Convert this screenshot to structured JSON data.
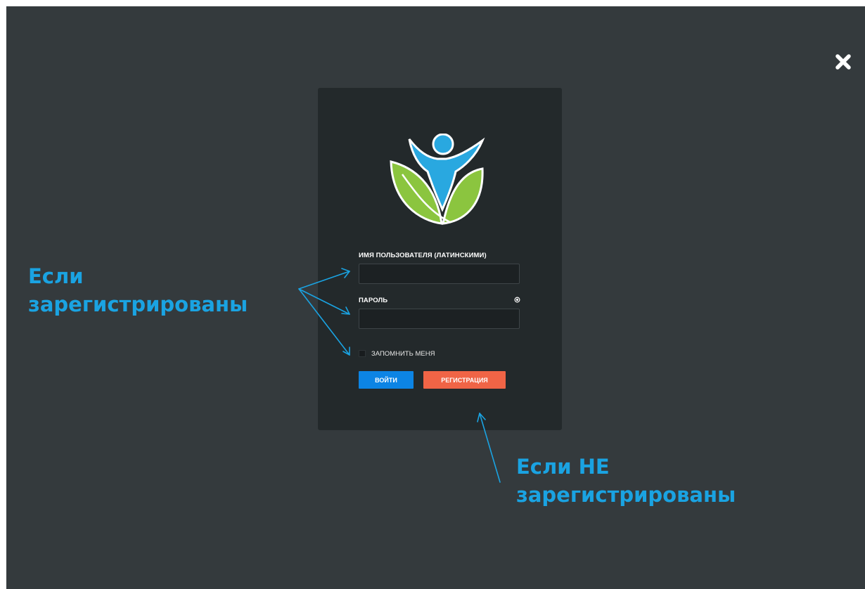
{
  "overlay": {
    "background_color": "#343a3d",
    "close_icon": "close-x-icon"
  },
  "login": {
    "logo_icon": "person-leaves-logo",
    "username_label": "ИМЯ ПОЛЬЗОВАТЕЛЯ (ЛАТИНСКИМИ)",
    "username_value": "",
    "password_label": "ПАРОЛЬ",
    "password_value": "",
    "password_help_icon": "question-circle-icon",
    "remember_me_label": "ЗАПОМНИТЬ МЕНЯ",
    "remember_me_checked": false,
    "login_button": "ВОЙТИ",
    "register_button": "РЕГИСТРАЦИЯ"
  },
  "annotations": {
    "registered": [
      "Если",
      "зарегистрированы"
    ],
    "not_registered": [
      "Если НЕ",
      "зарегистрированы"
    ]
  },
  "colors": {
    "login_button": "#0c84e4",
    "register_button": "#f06446",
    "annotation_text": "#1aa3e2",
    "panel": "#23292b"
  }
}
